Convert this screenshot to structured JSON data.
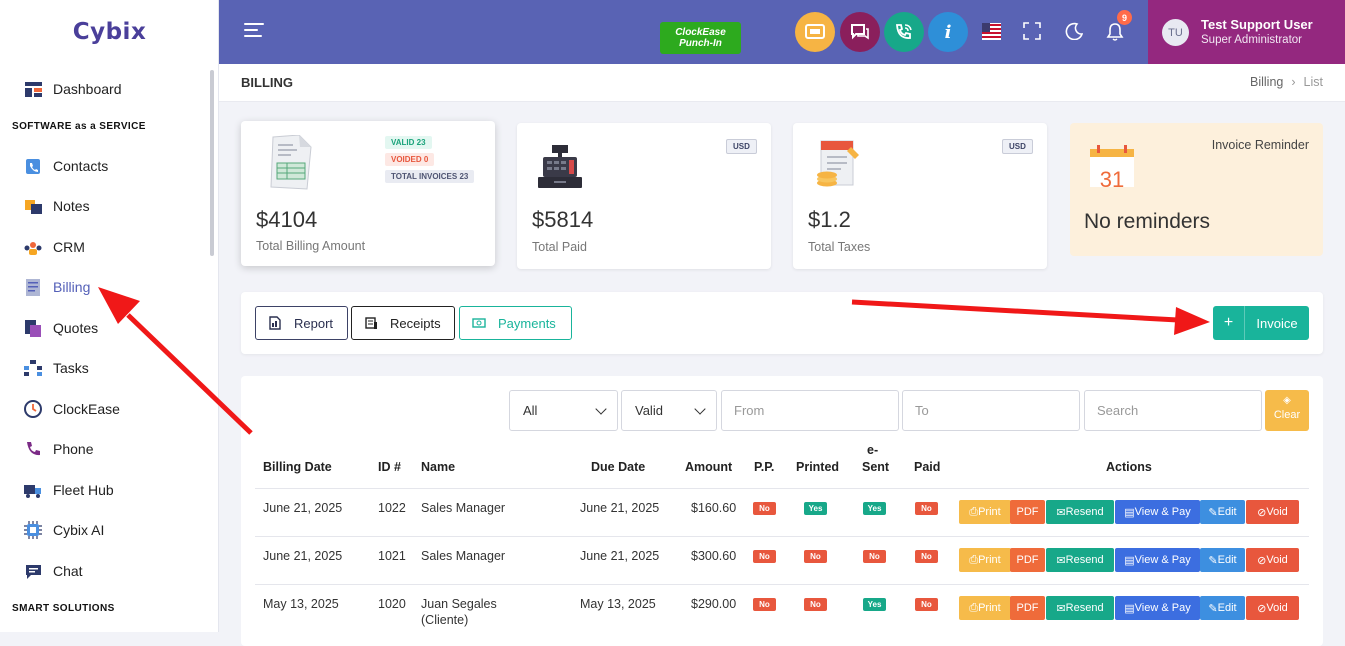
{
  "app": {
    "logo": "Cybix"
  },
  "sidebar": {
    "items": [
      {
        "label": "Dashboard"
      },
      {
        "label": "Contacts"
      },
      {
        "label": "Notes"
      },
      {
        "label": "CRM"
      },
      {
        "label": "Billing"
      },
      {
        "label": "Quotes"
      },
      {
        "label": "Tasks"
      },
      {
        "label": "ClockEase"
      },
      {
        "label": "Phone"
      },
      {
        "label": "Fleet Hub"
      },
      {
        "label": "Cybix AI"
      },
      {
        "label": "Chat"
      }
    ],
    "sections": {
      "saas": "SOFTWARE as a SERVICE",
      "smart": "SMART SOLUTIONS"
    }
  },
  "topbar": {
    "clockease_line1": "ClockEase",
    "clockease_line2": "Punch-In",
    "notification_count": "9",
    "user_initials": "TU",
    "user_name": "Test Support User",
    "user_role": "Super Administrator",
    "colors": {
      "bar": "#5963b4",
      "user_panel": "#94287f",
      "punch_in": "#2daa1e"
    }
  },
  "page": {
    "title": "BILLING",
    "breadcrumb": [
      "Billing",
      "List"
    ]
  },
  "cards": {
    "total_billing": {
      "amount": "$4104",
      "label": "Total Billing Amount",
      "valid": "VALID 23",
      "voided": "VOIDED 0",
      "total": "TOTAL INVOICES 23"
    },
    "total_paid": {
      "amount": "$5814",
      "label": "Total Paid",
      "currency": "USD"
    },
    "total_taxes": {
      "amount": "$1.2",
      "label": "Total Taxes",
      "currency": "USD"
    },
    "reminder": {
      "title": "Invoice Reminder",
      "text": "No reminders",
      "calendar_day": "31"
    }
  },
  "buttons": {
    "report": "Report",
    "receipts": "Receipts",
    "payments": "Payments",
    "invoice": "Invoice",
    "invoice_plus": "+"
  },
  "filters": {
    "type_selected": "All",
    "status_selected": "Valid",
    "from_placeholder": "From",
    "to_placeholder": "To",
    "search_placeholder": "Search",
    "clear_label": "Clear"
  },
  "table": {
    "headers": {
      "billing_date": "Billing Date",
      "id": "ID #",
      "name": "Name",
      "due_date": "Due Date",
      "amount": "Amount",
      "pp": "P.P.",
      "printed": "Printed",
      "esent_1": "e-",
      "esent_2": "Sent",
      "paid": "Paid",
      "actions": "Actions"
    },
    "actions": {
      "print": "Print",
      "pdf": "PDF",
      "resend": "Resend",
      "view_pay": "View & Pay",
      "edit": "Edit",
      "void": "Void"
    },
    "rows": [
      {
        "billing_date": "June 21, 2025",
        "id": "1022",
        "name": "Sales Manager",
        "name2": "",
        "due_date": "June 21, 2025",
        "amount": "$160.60",
        "pp": "No",
        "printed": "Yes",
        "esent": "Yes",
        "paid": "No"
      },
      {
        "billing_date": "June 21, 2025",
        "id": "1021",
        "name": "Sales Manager",
        "name2": "",
        "due_date": "June 21, 2025",
        "amount": "$300.60",
        "pp": "No",
        "printed": "No",
        "esent": "No",
        "paid": "No"
      },
      {
        "billing_date": "May 13, 2025",
        "id": "1020",
        "name": "Juan Segales",
        "name2": "(Cliente)",
        "due_date": "May 13, 2025",
        "amount": "$290.00",
        "pp": "No",
        "printed": "No",
        "esent": "Yes",
        "paid": "No"
      }
    ]
  }
}
